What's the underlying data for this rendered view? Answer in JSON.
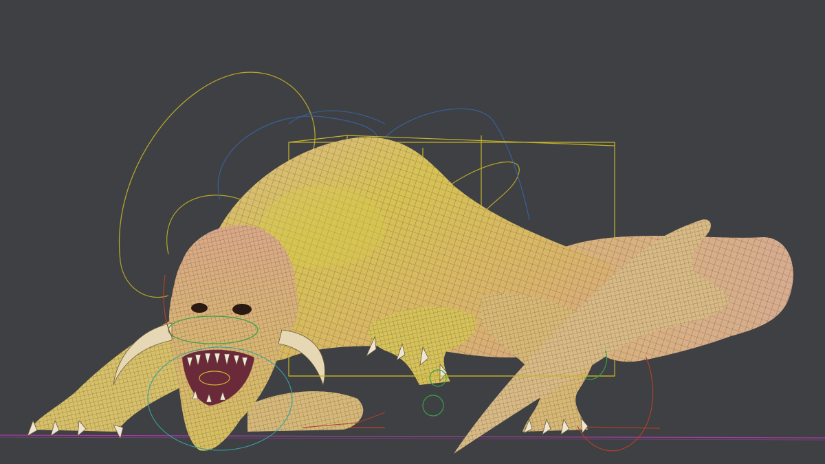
{
  "viewport": {
    "background": "#3e4043"
  },
  "subject": {
    "kind": "creature-3d-model",
    "skin_base": "#d6b560",
    "skin_yellow": "#d4c23a",
    "skin_pink": "#d8a488",
    "wire_color": "#4a3a1c",
    "mouth_color": "#6b2a3a",
    "claw_color": "#efe6d2"
  },
  "rig": {
    "bounding_box_color": "#c8b42a",
    "arc_color_yellow": "#b5a42a",
    "arc_color_blue": "#3a5f93",
    "arc_color_green": "#3aa14a",
    "arc_color_red": "#b0402a",
    "arc_color_cyan": "#3aa0a0",
    "ground_line_color": "#a040a0"
  }
}
